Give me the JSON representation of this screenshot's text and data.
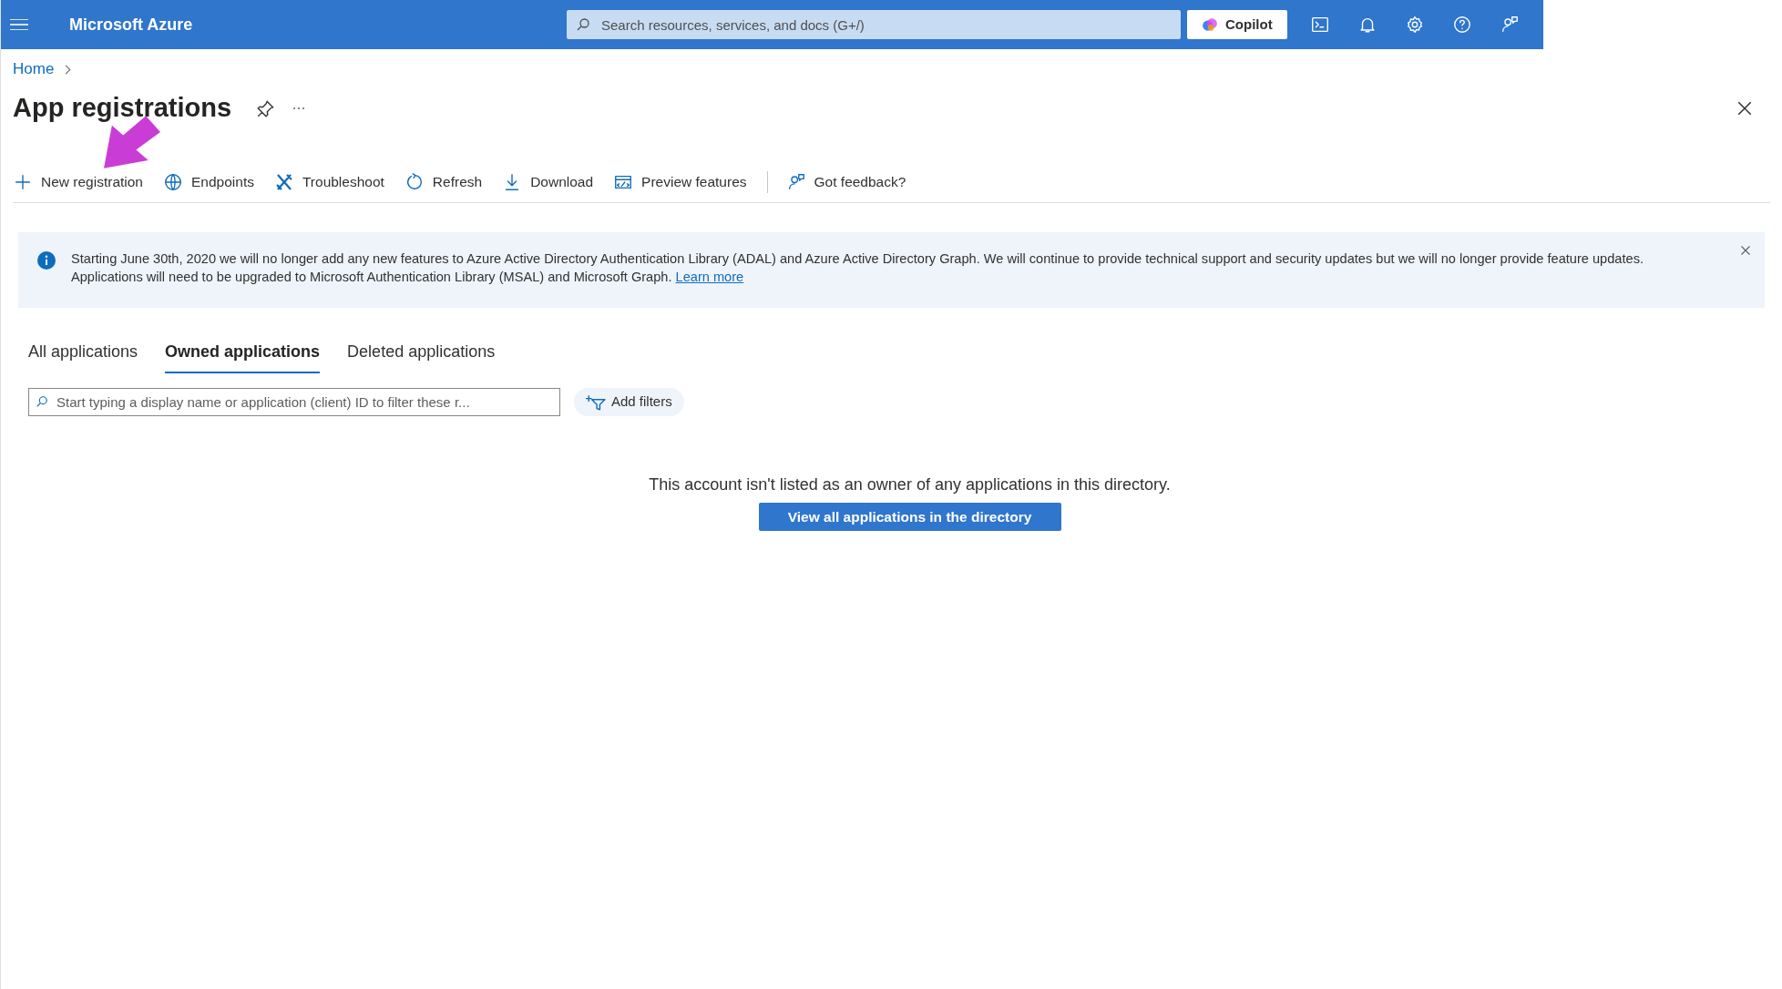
{
  "top_bar": {
    "brand": "Microsoft Azure",
    "search": {
      "placeholder": "Search resources, services, and docs (G+/)"
    },
    "copilot": "Copilot"
  },
  "breadcrumb": [
    "Home"
  ],
  "title": "App registrations",
  "toolbar": [
    {
      "kind": "add",
      "label": "New registration"
    },
    {
      "kind": "globe",
      "label": "Endpoints"
    },
    {
      "kind": "wrench",
      "label": "Troubleshoot"
    },
    {
      "kind": "refresh",
      "label": "Refresh"
    },
    {
      "kind": "download",
      "label": "Download"
    },
    {
      "kind": "preview",
      "label": "Preview features"
    },
    {
      "kind": "separator"
    },
    {
      "kind": "feedback",
      "label": "Got feedback?"
    }
  ],
  "banner": {
    "text": "Starting June 30th, 2020 we will no longer add any new features to Azure Active Directory Authentication Library (ADAL) and Azure Active Directory Graph. We will continue to provide technical support and security updates but we will no longer provide feature updates. Applications will need to be upgraded to Microsoft Authentication Library (MSAL) and Microsoft Graph.",
    "link": "Learn more"
  },
  "tabs": [
    {
      "label": "All applications",
      "selected": false
    },
    {
      "label": "Owned applications",
      "selected": true
    },
    {
      "label": "Deleted applications",
      "selected": false
    }
  ],
  "filter": {
    "placeholder": "Start typing a display name or application (client) ID to filter these r...",
    "add_filters": "Add filters"
  },
  "empty_state": {
    "message": "This account isn't listed as an owner of any applications in this directory.",
    "button": "View all applications in the directory"
  }
}
